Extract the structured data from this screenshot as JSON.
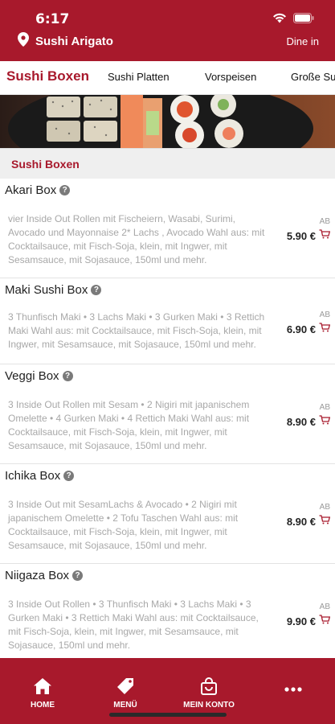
{
  "status": {
    "time": "6:17"
  },
  "header": {
    "location_name": "Sushi Arigato",
    "dine_in_label": "Dine in"
  },
  "tabs": [
    {
      "label": "Sushi Boxen",
      "active": true
    },
    {
      "label": "Sushi Platten",
      "active": false
    },
    {
      "label": "Vorspeisen",
      "active": false
    },
    {
      "label": "Große Su",
      "active": false
    }
  ],
  "section": {
    "title": "Sushi Boxen"
  },
  "items": [
    {
      "name": "Akari Box",
      "description": "vier Inside Out Rollen mit Fischeiern, Wasabi, Surimi, Avocado und Mayonnaise 2* Lachs , Avocado Wahl aus: mit Cocktailsauce, mit Fisch-Soja, klein, mit Ingwer, mit Sesamsauce, mit Sojasauce, 150ml und mehr.",
      "ab": "AB",
      "price": "5.90 €"
    },
    {
      "name": "Maki Sushi Box",
      "description": "3 Thunfisch Maki • 3 Lachs Maki • 3 Gurken Maki • 3 Rettich Maki Wahl aus: mit Cocktailsauce, mit Fisch-Soja, klein, mit Ingwer, mit Sesamsauce, mit Sojasauce, 150ml und mehr.",
      "ab": "AB",
      "price": "6.90 €"
    },
    {
      "name": "Veggi Box",
      "description": "3 Inside Out Rollen mit Sesam • 2 Nigiri mit japanischem Omelette • 4 Gurken Maki • 4 Rettich Maki Wahl aus: mit Cocktailsauce, mit Fisch-Soja, klein, mit Ingwer, mit Sesamsauce, mit Sojasauce, 150ml und mehr.",
      "ab": "AB",
      "price": "8.90 €"
    },
    {
      "name": "Ichika Box",
      "description": "3 Inside Out mit SesamLachs & Avocado • 2 Nigiri mit japanischem Omelette • 2 Tofu Taschen Wahl aus: mit Cocktailsauce, mit Fisch-Soja, klein, mit Ingwer, mit Sesamsauce, mit Sojasauce, 150ml und mehr.",
      "ab": "AB",
      "price": "8.90 €"
    },
    {
      "name": "Niigaza Box",
      "description": "3 Inside Out Rollen • 3 Thunfisch Maki • 3 Lachs Maki • 3 Gurken Maki • 3 Rettich Maki Wahl aus: mit Cocktailsauce, mit Fisch-Soja, klein, mit Ingwer, mit Sesamsauce, mit Sojasauce, 150ml und mehr.",
      "ab": "AB",
      "price": "9.90 €"
    }
  ],
  "bottom_nav": [
    {
      "label": "HOME",
      "icon": "home-icon"
    },
    {
      "label": "MENÜ",
      "icon": "tag-icon"
    },
    {
      "label": "MEIN KONTO",
      "icon": "bag-icon"
    },
    {
      "label": "",
      "icon": "more-icon"
    }
  ],
  "colors": {
    "brand": "#a8192c",
    "section_bg": "#efefef",
    "desc_text": "#a8a8a8"
  }
}
